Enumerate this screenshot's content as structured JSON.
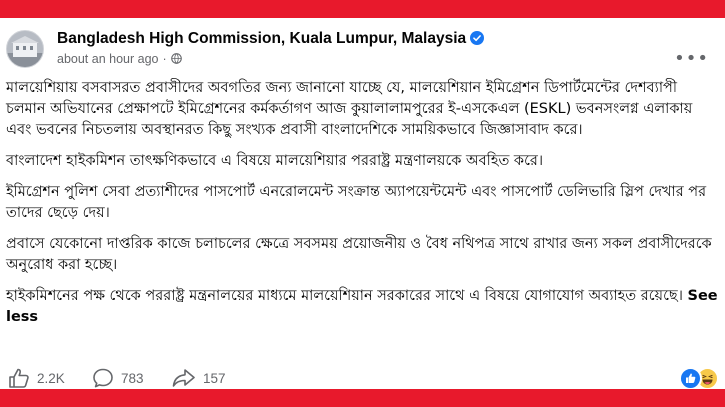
{
  "post": {
    "page_name": "Bangladesh High Commission, Kuala Lumpur, Malaysia",
    "time": "about an hour ago",
    "separator": "·",
    "paragraphs": [
      "মালয়েশিয়ায় বসবাসরত প্রবাসীদের অবগতির জন্য জানানো যাচ্ছে যে, মালয়েশিয়ান ইমিগ্রেশন ডিপার্টমেন্টের দেশব্যাপী চলমান অভিযানের  প্রেক্ষাপটে ইমিগ্রেশনের কর্মকর্তাগণ আজ কুয়ালালামপুরের ই-এসকেএল (ESKL) ভবনসংলগ্ন এলাকায় এবং ভবনের নিচতলায় অবস্থানরত কিছু সংখ্যক প্রবাসী বাংলাদেশিকে সাময়িকভাবে জিজ্ঞাসাবাদ করে।",
      "বাংলাদেশ হাইকমিশন তাৎক্ষণিকভাবে এ বিষয়ে মালয়েশিয়ার পররাষ্ট্র মন্ত্রণালয়কে অবহিত করে।",
      "ইমিগ্রেশন পুলিশ সেবা প্রত্যাশীদের পাসপোর্ট এনরোলমেন্ট সংক্রান্ত অ্যাপয়েন্টমেন্ট এবং পাসপোর্ট ডেলিভারি স্লিপ দেখার পর তাদের ছেড়ে দেয়।",
      "প্রবাসে যেকোনো দাপ্তরিক কাজে চলাচলের ক্ষেত্রে সবসময় প্রয়োজনীয় ও বৈধ নথিপত্র সাথে রাখার জন্য সকল প্রবাসীদেরকে অনুরোধ করা হচ্ছে।"
    ],
    "last_paragraph": "হাইকমিশনের পক্ষ থেকে পররাষ্ট্র মন্ত্রনালয়ের মাধ্যমে মালয়েশিয়ান সরকারের সাথে এ বিষয়ে যোগাযোগ অব্যাহত রয়েছে।",
    "see_less": "See less"
  },
  "stats": {
    "likes": "2.2K",
    "comments": "783",
    "shares": "157"
  },
  "colors": {
    "frame": "#e8192c",
    "verified": "#1877f2",
    "muted": "#65676b"
  },
  "icons": [
    "avatar",
    "verified-badge-icon",
    "globe-icon",
    "more-options-icon",
    "like-icon",
    "comment-icon",
    "share-icon",
    "like-reaction-icon",
    "haha-reaction-icon"
  ]
}
